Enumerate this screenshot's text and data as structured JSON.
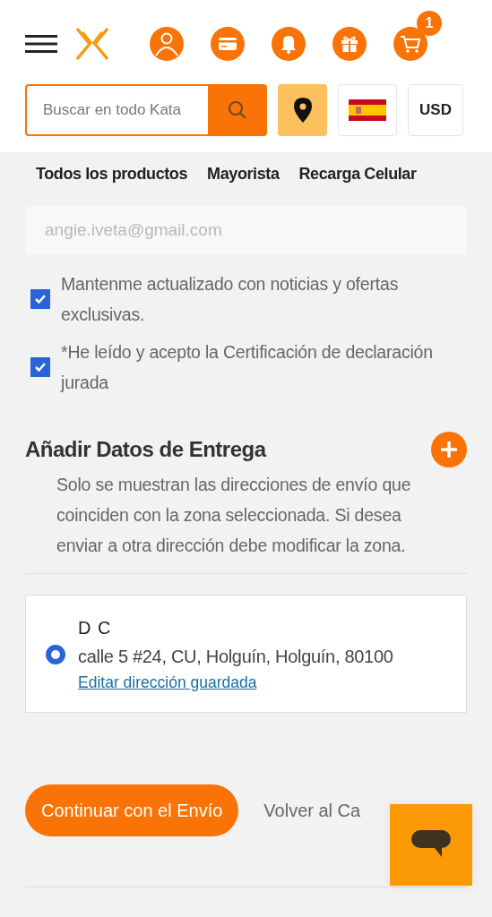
{
  "header": {
    "cart_count": "1",
    "search": {
      "placeholder": "Buscar en todo Kata"
    },
    "currency": "USD"
  },
  "nav": [
    "Todos los productos",
    "Mayorista",
    "Recarga Celular"
  ],
  "email": {
    "value": "angie.iveta@gmail.com",
    "disabled": true
  },
  "checkboxes": [
    {
      "label": "Mantenme actualizado con noticias y ofertas exclusivas.",
      "checked": true
    },
    {
      "label": "*He leído y acepto la  Certificación de declaración jurada",
      "checked": true
    }
  ],
  "delivery": {
    "title": "Añadir Datos de Entrega",
    "note": "Solo se muestran las direcciones de envío que coinciden con la zona seleccionada. Si desea enviar a otra dirección debe modificar la zona.",
    "addresses": [
      {
        "name": "D C",
        "address": "calle 5 #24, CU, Holguín, Holguín, 80100",
        "edit_link": "Editar dirección guardada",
        "selected": true
      }
    ]
  },
  "actions": {
    "primary": "Continuar con el Envío",
    "secondary": "Volver al Ca"
  }
}
